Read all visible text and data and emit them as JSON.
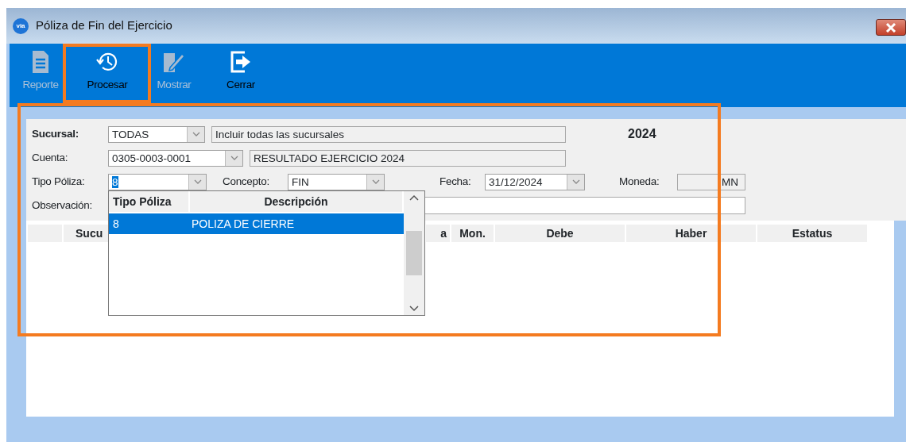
{
  "window": {
    "title": "Póliza de Fin del Ejercicio",
    "logo_text": "via"
  },
  "toolbar": [
    {
      "label": "Reporte",
      "kind": "report",
      "disabled": true,
      "highlighted": false
    },
    {
      "label": "Procesar",
      "kind": "history",
      "disabled": false,
      "highlighted": true
    },
    {
      "label": "Mostrar",
      "kind": "edit",
      "disabled": true,
      "highlighted": false
    },
    {
      "label": "Cerrar",
      "kind": "exit",
      "disabled": false,
      "highlighted": false
    }
  ],
  "form": {
    "highlighted": true,
    "year": "2024",
    "sucursal": {
      "label": "Sucursal:",
      "value": "TODAS",
      "description": "Incluir todas las sucursales"
    },
    "cuenta": {
      "label": "Cuenta:",
      "value": "0305-0003-0001",
      "description": "RESULTADO EJERCICIO 2024"
    },
    "tipo_poliza": {
      "label": "Tipo Póliza:",
      "value": "8"
    },
    "concepto": {
      "label": "Concepto:",
      "value": "FIN"
    },
    "fecha": {
      "label": "Fecha:",
      "value": "31/12/2024"
    },
    "moneda": {
      "label": "Moneda:",
      "value": "MN"
    },
    "observacion": {
      "label": "Observación:"
    }
  },
  "dropdown": {
    "columns": [
      "Tipo Póliza",
      "Descripción"
    ],
    "rows": [
      {
        "cells": [
          "8",
          "POLIZA DE CIERRE"
        ],
        "selected": true
      }
    ]
  },
  "table": {
    "columns": [
      "Sucu",
      "a",
      "Mon.",
      "Debe",
      "Haber",
      "Estatus"
    ]
  }
}
